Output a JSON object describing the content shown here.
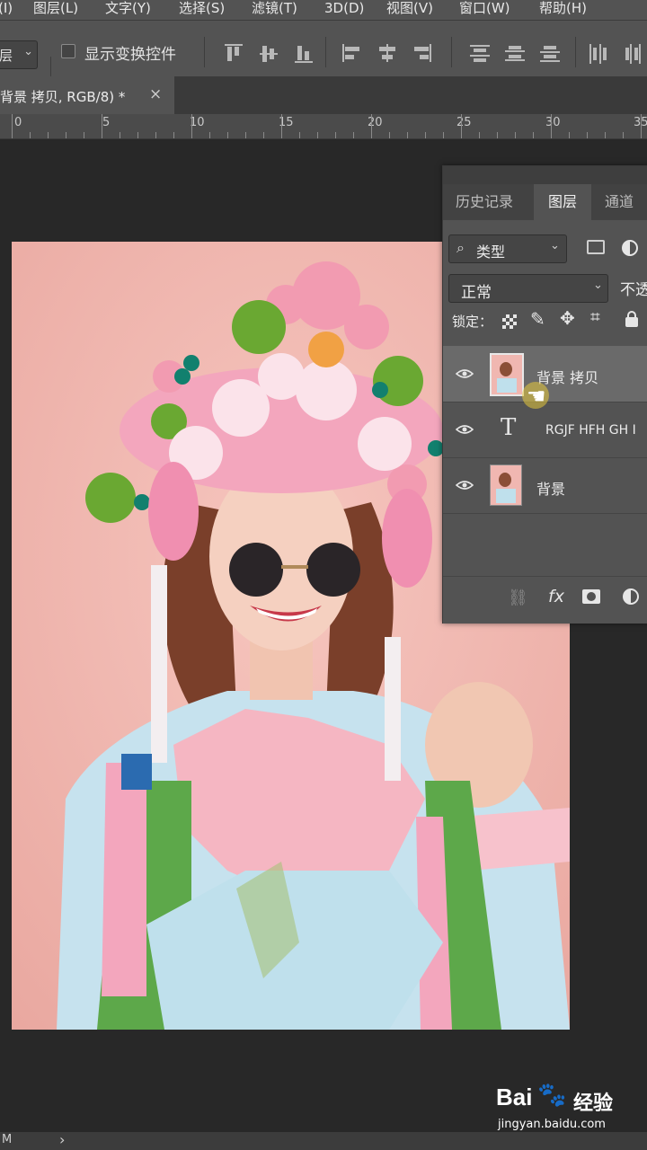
{
  "menu": [
    "(I)",
    "图层(L)",
    "文字(Y)",
    "选择(S)",
    "滤镜(T)",
    "3D(D)",
    "视图(V)",
    "窗口(W)",
    "帮助(H)"
  ],
  "options": {
    "select_text": "层",
    "show_transform_label": "显示变换控件"
  },
  "document_tab": {
    "title": "背景 拷贝, RGB/8) *",
    "close": "×"
  },
  "ruler": [
    "0",
    "5",
    "10",
    "15",
    "20",
    "25",
    "30",
    "35"
  ],
  "layers_panel": {
    "tabs": [
      "历史记录",
      "图层",
      "通道"
    ],
    "active_tab": "图层",
    "filter_label": "类型",
    "blend_mode": "正常",
    "opacity_label": "不透",
    "lock_label": "锁定：",
    "layers": [
      {
        "name": "背景 拷贝",
        "type": "image",
        "selected": true
      },
      {
        "name": "RGJF HFH GH I",
        "type": "text",
        "selected": false
      },
      {
        "name": "背景",
        "type": "image",
        "selected": false
      }
    ],
    "footer_fx": "fx"
  },
  "status": {
    "left": "M",
    "arrow": "›"
  },
  "watermark": {
    "brand": "Bai",
    "brand_suffix": "经验",
    "url": "jingyan.baidu.com"
  },
  "colors": {
    "ui_bg": "#535353",
    "canvas_bg": "#282828",
    "photo_bg": "#efb4ad"
  }
}
